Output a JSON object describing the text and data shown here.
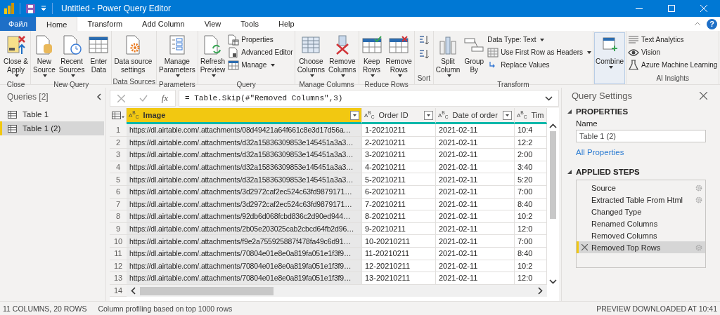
{
  "window": {
    "title": "Untitled - Power Query Editor"
  },
  "menu_tabs": [
    {
      "label": "Файл",
      "kind": "file",
      "selected": false
    },
    {
      "label": "Home",
      "kind": "tab",
      "selected": true
    },
    {
      "label": "Transform",
      "kind": "tab",
      "selected": false
    },
    {
      "label": "Add Column",
      "kind": "tab",
      "selected": false
    },
    {
      "label": "View",
      "kind": "tab",
      "selected": false
    },
    {
      "label": "Tools",
      "kind": "tab",
      "selected": false
    },
    {
      "label": "Help",
      "kind": "tab",
      "selected": false
    }
  ],
  "help_button": "?",
  "ribbon": [
    {
      "label": "Close",
      "items": [
        {
          "kind": "large",
          "label": "Close &\nApply",
          "dropdown": true
        }
      ]
    },
    {
      "label": "New Query",
      "items": [
        {
          "kind": "large",
          "label": "New\nSource",
          "dropdown": true
        },
        {
          "kind": "large",
          "label": "Recent\nSources",
          "dropdown": true
        },
        {
          "kind": "large",
          "label": "Enter\nData",
          "dropdown": false
        }
      ]
    },
    {
      "label": "Data Sources",
      "items": [
        {
          "kind": "large",
          "label": "Data source\nsettings",
          "dropdown": false
        }
      ]
    },
    {
      "label": "Parameters",
      "items": [
        {
          "kind": "large",
          "label": "Manage\nParameters",
          "dropdown": true
        }
      ]
    },
    {
      "label": "Query",
      "items": [
        {
          "kind": "large",
          "label": "Refresh\nPreview",
          "dropdown": true
        },
        {
          "kind": "stack",
          "items": [
            {
              "label": "Properties",
              "dropdown": false
            },
            {
              "label": "Advanced Editor",
              "dropdown": false
            },
            {
              "label": "Manage",
              "dropdown": true
            }
          ]
        }
      ]
    },
    {
      "label": "Manage Columns",
      "items": [
        {
          "kind": "large",
          "label": "Choose\nColumns",
          "dropdown": true
        },
        {
          "kind": "large",
          "label": "Remove\nColumns",
          "dropdown": true
        }
      ]
    },
    {
      "label": "Reduce Rows",
      "items": [
        {
          "kind": "large",
          "label": "Keep\nRows",
          "dropdown": true
        },
        {
          "kind": "large",
          "label": "Remove\nRows",
          "dropdown": true
        }
      ]
    },
    {
      "label": "Sort",
      "items": [
        {
          "kind": "icons"
        }
      ]
    },
    {
      "label": "Transform",
      "items": [
        {
          "kind": "large",
          "label": "Split\nColumn",
          "dropdown": true
        },
        {
          "kind": "large",
          "label": "Group\nBy",
          "dropdown": false
        },
        {
          "kind": "stack",
          "items": [
            {
              "label": "Data Type: Text",
              "dropdown": true
            },
            {
              "label": "Use First Row as Headers",
              "dropdown": true
            },
            {
              "label": "Replace Values",
              "dropdown": false
            }
          ]
        }
      ]
    },
    {
      "items": [
        {
          "kind": "large",
          "label": "Combine",
          "dropdown": true,
          "highlighted": true
        }
      ]
    },
    {
      "label": "AI Insights",
      "items": [
        {
          "kind": "stack",
          "items": [
            {
              "label": "Text Analytics",
              "dropdown": false
            },
            {
              "label": "Vision",
              "dropdown": false
            },
            {
              "label": "Azure Machine Learning",
              "dropdown": false
            }
          ]
        }
      ]
    }
  ],
  "queries": {
    "title": "Queries [2]",
    "items": [
      {
        "label": "Table 1",
        "selected": false
      },
      {
        "label": "Table 1 (2)",
        "selected": true
      }
    ]
  },
  "formula_bar": {
    "function_label": "fx",
    "formula": "= Table.Skip(#\"Removed Columns\",3)"
  },
  "table": {
    "columns": [
      {
        "type_label": "A$^{B}$$_{C}$",
        "name": "Image",
        "selected": true
      },
      {
        "type_label": "A$^{B}$$_{C}$",
        "name": "Order ID",
        "selected": false
      },
      {
        "type_label": "A$^{B}$$_{C}$",
        "name": "Date of order",
        "selected": false
      },
      {
        "type_label": "A$^{B}$$_{C}$",
        "name": "Tim",
        "selected": false
      }
    ],
    "rows": [
      {
        "number": "1",
        "cells": [
          "https://dl.airtable.com/.attachments/08d49421a64f661c8e3d17d56a…",
          "1-20210211",
          "2021-02-11",
          "10:4"
        ]
      },
      {
        "number": "2",
        "cells": [
          "https://dl.airtable.com/.attachments/d32a15836309853e145451a3a3…",
          "2-20210211",
          "2021-02-11",
          "12:2"
        ]
      },
      {
        "number": "3",
        "cells": [
          "https://dl.airtable.com/.attachments/d32a15836309853e145451a3a3…",
          "3-20210211",
          "2021-02-11",
          "2:00"
        ]
      },
      {
        "number": "4",
        "cells": [
          "https://dl.airtable.com/.attachments/d32a15836309853e145451a3a3…",
          "4-20210211",
          "2021-02-11",
          "3:40"
        ]
      },
      {
        "number": "5",
        "cells": [
          "https://dl.airtable.com/.attachments/d32a15836309853e145451a3a3…",
          "5-20210211",
          "2021-02-11",
          "5:20"
        ]
      },
      {
        "number": "6",
        "cells": [
          "https://dl.airtable.com/.attachments/3d2972caf2ec524c63fd9879171…",
          "6-20210211",
          "2021-02-11",
          "7:00"
        ]
      },
      {
        "number": "7",
        "cells": [
          "https://dl.airtable.com/.attachments/3d2972caf2ec524c63fd9879171…",
          "7-20210211",
          "2021-02-11",
          "8:40"
        ]
      },
      {
        "number": "8",
        "cells": [
          "https://dl.airtable.com/.attachments/92db6d068fcbd836c2d90ed944…",
          "8-20210211",
          "2021-02-11",
          "10:2"
        ]
      },
      {
        "number": "9",
        "cells": [
          "https://dl.airtable.com/.attachments/2b05e203025cab2cbcd64fb2d96…",
          "9-20210211",
          "2021-02-11",
          "12:0"
        ]
      },
      {
        "number": "10",
        "cells": [
          "https://dl.airtable.com/.attachments/f9e2a755925887f478fa49c6d91…",
          "10-20210211",
          "2021-02-11",
          "7:00"
        ]
      },
      {
        "number": "11",
        "cells": [
          "https://dl.airtable.com/.attachments/70804e01e8e0a819fa051e1f3f9…",
          "11-20210211",
          "2021-02-11",
          "8:40"
        ]
      },
      {
        "number": "12",
        "cells": [
          "https://dl.airtable.com/.attachments/70804e01e8e0a819fa051e1f3f9…",
          "12-20210211",
          "2021-02-11",
          "10:2"
        ]
      },
      {
        "number": "13",
        "cells": [
          "https://dl.airtable.com/.attachments/70804e01e8e0a819fa051e1f3f9…",
          "13-20210211",
          "2021-02-11",
          "12:0"
        ]
      }
    ],
    "partial_row_number": "14"
  },
  "query_settings": {
    "title": "Query Settings",
    "properties_heading": "PROPERTIES",
    "name_label": "Name",
    "name_value": "Table 1 (2)",
    "all_properties_link": "All Properties",
    "steps_heading": "APPLIED STEPS",
    "applied_steps": [
      {
        "label": "Source",
        "settings": true,
        "selected": false
      },
      {
        "label": "Extracted Table From Html",
        "settings": true,
        "selected": false
      },
      {
        "label": "Changed Type",
        "settings": false,
        "selected": false
      },
      {
        "label": "Renamed Columns",
        "settings": false,
        "selected": false
      },
      {
        "label": "Removed Columns",
        "settings": false,
        "selected": false
      },
      {
        "label": "Removed Top Rows",
        "settings": true,
        "selected": true
      }
    ]
  },
  "status_bar": {
    "counts": "11 COLUMNS, 20 ROWS",
    "profiling": "Column profiling based on top 1000 rows",
    "preview": "PREVIEW DOWNLOADED AT 10:41"
  }
}
